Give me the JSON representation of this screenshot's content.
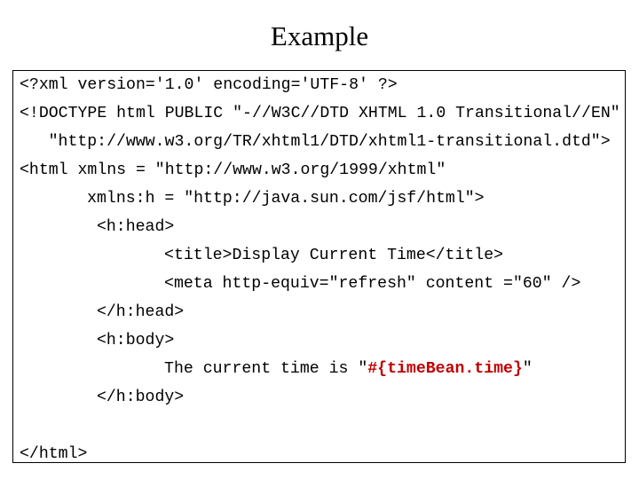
{
  "slide": {
    "title": "Example",
    "title_color": "#000000",
    "background_color": "#ffffff",
    "border_color": "#000000"
  },
  "code": {
    "language": "xhtml",
    "expression_color": "#c00000",
    "lines": [
      {
        "indent": 0,
        "text": "<?xml version='1.0' encoding='UTF-8' ?>"
      },
      {
        "indent": 0,
        "text": "<!DOCTYPE html PUBLIC \"-//W3C//DTD XHTML 1.0 Transitional//EN\""
      },
      {
        "indent": 3,
        "text": "\"http://www.w3.org/TR/xhtml1/DTD/xhtml1-transitional.dtd\">"
      },
      {
        "indent": 0,
        "text": "<html xmlns = \"http://www.w3.org/1999/xhtml\""
      },
      {
        "indent": 7,
        "text": "xmlns:h = \"http://java.sun.com/jsf/html\">"
      },
      {
        "indent": 8,
        "text": "<h:head>"
      },
      {
        "indent": 15,
        "text": "<title>Display Current Time</title>"
      },
      {
        "indent": 15,
        "text": "<meta http-equiv=\"refresh\" content =\"60\" />"
      },
      {
        "indent": 8,
        "text": "</h:head>"
      },
      {
        "indent": 8,
        "text": "<h:body>"
      },
      {
        "indent": 15,
        "pre": "The current time is \"",
        "expr": "#{timeBean.time}",
        "post": "\""
      },
      {
        "indent": 8,
        "text": "</h:body>"
      },
      {
        "indent": 0,
        "text": ""
      },
      {
        "indent": 0,
        "text": "</html>"
      }
    ]
  }
}
